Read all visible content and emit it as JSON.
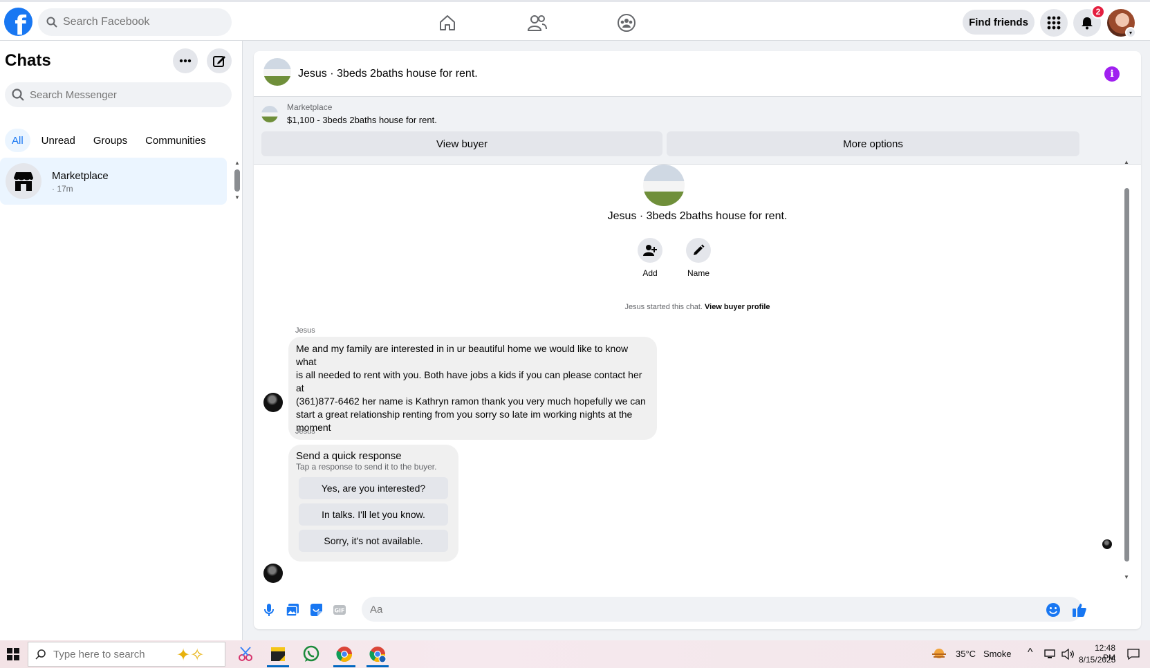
{
  "topbar": {
    "search_placeholder": "Search Facebook",
    "find_friends": "Find friends",
    "notification_count": "2"
  },
  "sidebar": {
    "title": "Chats",
    "search_placeholder": "Search Messenger",
    "tabs": [
      "All",
      "Unread",
      "Groups",
      "Communities"
    ],
    "chat": {
      "name": "Marketplace",
      "time": "· 17m"
    }
  },
  "chat": {
    "header_title": "Jesus · 3beds 2baths house for rent.",
    "marketplace_label": "Marketplace",
    "listing": "$1,100 - 3beds 2baths house for rent.",
    "view_buyer": "View buyer",
    "more_options": "More options",
    "conversation_title": "Jesus · 3beds 2baths house for rent.",
    "actions": {
      "add": "Add",
      "name": "Name"
    },
    "started_text": "Jesus started this chat.",
    "view_buyer_profile": "View buyer profile",
    "messages": [
      {
        "sender": "Jesus",
        "lines": [
          "Me and my family are interested in in ur beautiful home we would like to know what",
          "is all needed to rent with you. Both have jobs a kids if you can please contact her at",
          "(361)877-6462 her name is Kathryn ramon  thank you very much hopefully we can",
          "start a great relationship renting from you sorry so late im working nights at the",
          "moment"
        ]
      },
      {
        "sender": "Jesus",
        "quick_title": "Send a quick response",
        "quick_sub": "Tap a response to send it to the buyer.",
        "options": [
          "Yes, are you interested?",
          "In talks. I'll let you know.",
          "Sorry, it's not available."
        ]
      }
    ],
    "composer_placeholder": "Aa"
  },
  "taskbar": {
    "search_placeholder": "Type here to search",
    "weather_temp": "35°C",
    "weather_desc": "Smoke",
    "time": "12:48 PM",
    "date": "8/15/2025"
  },
  "colors": {
    "brand": "#1877f2",
    "active_tab_bg": "#ebf5ff",
    "info": "#a020f0",
    "badge": "#e41e3f"
  }
}
